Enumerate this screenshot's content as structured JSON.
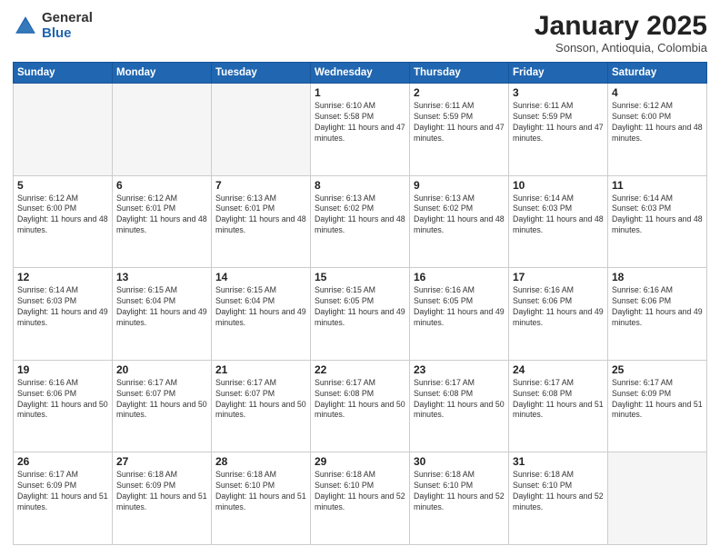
{
  "header": {
    "logo_general": "General",
    "logo_blue": "Blue",
    "month": "January 2025",
    "location": "Sonson, Antioquia, Colombia"
  },
  "days_of_week": [
    "Sunday",
    "Monday",
    "Tuesday",
    "Wednesday",
    "Thursday",
    "Friday",
    "Saturday"
  ],
  "weeks": [
    [
      {
        "day": "",
        "empty": true
      },
      {
        "day": "",
        "empty": true
      },
      {
        "day": "",
        "empty": true
      },
      {
        "day": "1",
        "sunrise": "6:10 AM",
        "sunset": "5:58 PM",
        "daylight": "11 hours and 47 minutes."
      },
      {
        "day": "2",
        "sunrise": "6:11 AM",
        "sunset": "5:59 PM",
        "daylight": "11 hours and 47 minutes."
      },
      {
        "day": "3",
        "sunrise": "6:11 AM",
        "sunset": "5:59 PM",
        "daylight": "11 hours and 47 minutes."
      },
      {
        "day": "4",
        "sunrise": "6:12 AM",
        "sunset": "6:00 PM",
        "daylight": "11 hours and 48 minutes."
      }
    ],
    [
      {
        "day": "5",
        "sunrise": "6:12 AM",
        "sunset": "6:00 PM",
        "daylight": "11 hours and 48 minutes."
      },
      {
        "day": "6",
        "sunrise": "6:12 AM",
        "sunset": "6:01 PM",
        "daylight": "11 hours and 48 minutes."
      },
      {
        "day": "7",
        "sunrise": "6:13 AM",
        "sunset": "6:01 PM",
        "daylight": "11 hours and 48 minutes."
      },
      {
        "day": "8",
        "sunrise": "6:13 AM",
        "sunset": "6:02 PM",
        "daylight": "11 hours and 48 minutes."
      },
      {
        "day": "9",
        "sunrise": "6:13 AM",
        "sunset": "6:02 PM",
        "daylight": "11 hours and 48 minutes."
      },
      {
        "day": "10",
        "sunrise": "6:14 AM",
        "sunset": "6:03 PM",
        "daylight": "11 hours and 48 minutes."
      },
      {
        "day": "11",
        "sunrise": "6:14 AM",
        "sunset": "6:03 PM",
        "daylight": "11 hours and 48 minutes."
      }
    ],
    [
      {
        "day": "12",
        "sunrise": "6:14 AM",
        "sunset": "6:03 PM",
        "daylight": "11 hours and 49 minutes."
      },
      {
        "day": "13",
        "sunrise": "6:15 AM",
        "sunset": "6:04 PM",
        "daylight": "11 hours and 49 minutes."
      },
      {
        "day": "14",
        "sunrise": "6:15 AM",
        "sunset": "6:04 PM",
        "daylight": "11 hours and 49 minutes."
      },
      {
        "day": "15",
        "sunrise": "6:15 AM",
        "sunset": "6:05 PM",
        "daylight": "11 hours and 49 minutes."
      },
      {
        "day": "16",
        "sunrise": "6:16 AM",
        "sunset": "6:05 PM",
        "daylight": "11 hours and 49 minutes."
      },
      {
        "day": "17",
        "sunrise": "6:16 AM",
        "sunset": "6:06 PM",
        "daylight": "11 hours and 49 minutes."
      },
      {
        "day": "18",
        "sunrise": "6:16 AM",
        "sunset": "6:06 PM",
        "daylight": "11 hours and 49 minutes."
      }
    ],
    [
      {
        "day": "19",
        "sunrise": "6:16 AM",
        "sunset": "6:06 PM",
        "daylight": "11 hours and 50 minutes."
      },
      {
        "day": "20",
        "sunrise": "6:17 AM",
        "sunset": "6:07 PM",
        "daylight": "11 hours and 50 minutes."
      },
      {
        "day": "21",
        "sunrise": "6:17 AM",
        "sunset": "6:07 PM",
        "daylight": "11 hours and 50 minutes."
      },
      {
        "day": "22",
        "sunrise": "6:17 AM",
        "sunset": "6:08 PM",
        "daylight": "11 hours and 50 minutes."
      },
      {
        "day": "23",
        "sunrise": "6:17 AM",
        "sunset": "6:08 PM",
        "daylight": "11 hours and 50 minutes."
      },
      {
        "day": "24",
        "sunrise": "6:17 AM",
        "sunset": "6:08 PM",
        "daylight": "11 hours and 51 minutes."
      },
      {
        "day": "25",
        "sunrise": "6:17 AM",
        "sunset": "6:09 PM",
        "daylight": "11 hours and 51 minutes."
      }
    ],
    [
      {
        "day": "26",
        "sunrise": "6:17 AM",
        "sunset": "6:09 PM",
        "daylight": "11 hours and 51 minutes."
      },
      {
        "day": "27",
        "sunrise": "6:18 AM",
        "sunset": "6:09 PM",
        "daylight": "11 hours and 51 minutes."
      },
      {
        "day": "28",
        "sunrise": "6:18 AM",
        "sunset": "6:10 PM",
        "daylight": "11 hours and 51 minutes."
      },
      {
        "day": "29",
        "sunrise": "6:18 AM",
        "sunset": "6:10 PM",
        "daylight": "11 hours and 52 minutes."
      },
      {
        "day": "30",
        "sunrise": "6:18 AM",
        "sunset": "6:10 PM",
        "daylight": "11 hours and 52 minutes."
      },
      {
        "day": "31",
        "sunrise": "6:18 AM",
        "sunset": "6:10 PM",
        "daylight": "11 hours and 52 minutes."
      },
      {
        "day": "",
        "empty": true
      }
    ]
  ]
}
